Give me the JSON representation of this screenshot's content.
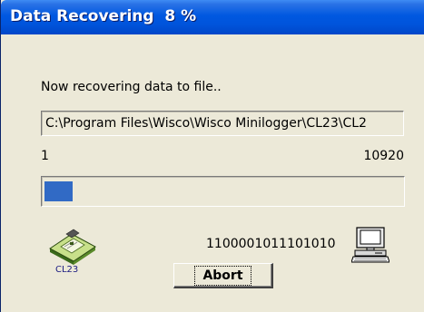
{
  "window": {
    "title": "Data Recovering  8 %"
  },
  "message": "Now recovering data to file..",
  "file_path": "C:\\Program Files\\Wisco\\Wisco Minilogger\\CL23\\CL2",
  "progress": {
    "min_label": "1",
    "max_label": "10920",
    "fraction": 0.08
  },
  "device": {
    "label": "CL23",
    "icon": "logger-device-icon"
  },
  "transfer_bits": "1100001011101010",
  "computer_icon": "computer-icon",
  "abort_label": "Abort",
  "colors": {
    "titlebar": "#0054dc",
    "progress_fill": "#316ac5",
    "window_bg": "#ece9d8"
  }
}
